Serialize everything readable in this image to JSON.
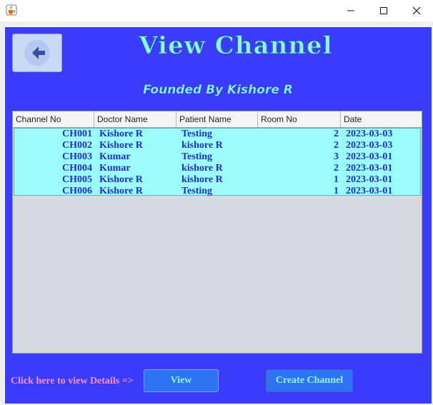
{
  "window": {
    "icons": {
      "app": "java-cup-icon",
      "minimize": "minimize-icon",
      "maximize": "maximize-icon",
      "close": "close-icon"
    }
  },
  "header": {
    "back_icon": "arrow-left-icon",
    "title": "View Channel",
    "subtitle": "Founded By Kishore R"
  },
  "table": {
    "columns": [
      "Channel No",
      "Doctor Name",
      "Patient Name",
      "Room No",
      "Date"
    ],
    "rows": [
      [
        "CH001",
        "Kishore R",
        "Testing",
        "2",
        "2023-03-03"
      ],
      [
        "CH002",
        "Kishore R",
        "kishore R",
        "2",
        "2023-03-03"
      ],
      [
        "CH003",
        "Kumar",
        "Testing",
        "3",
        "2023-03-01"
      ],
      [
        "CH004",
        "Kumar",
        "kishore R",
        "2",
        "2023-03-01"
      ],
      [
        "CH005",
        "Kishore R",
        "kishore R",
        "1",
        "2023-03-01"
      ],
      [
        "CH006",
        "Kishore R",
        "Testing",
        "1",
        "2023-03-01"
      ]
    ]
  },
  "footer": {
    "hint": "Click here to view Details =>",
    "view_label": "View",
    "create_label": "Create Channel"
  },
  "colors": {
    "panel": "#3b3bfc",
    "row_background": "#9cfcfc",
    "row_text": "#1d2fd0",
    "title_text": "#8ff4f0",
    "hint_text": "#ff8fc0",
    "button": "#2f72f5"
  }
}
